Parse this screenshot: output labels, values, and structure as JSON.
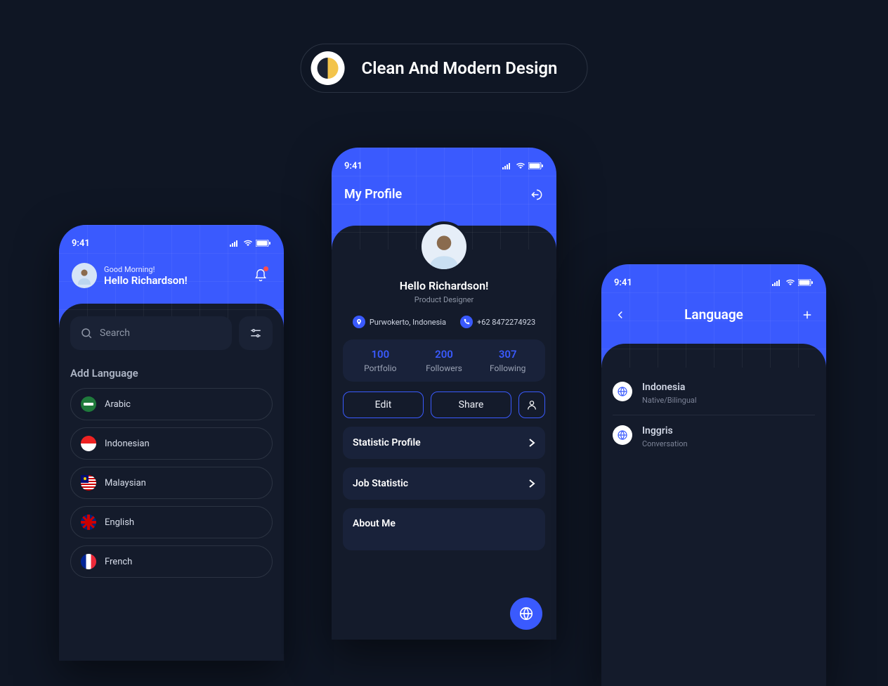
{
  "header": {
    "title": "Clean And Modern Design"
  },
  "status_time": "9:41",
  "left": {
    "greeting_sub": "Good Morning!",
    "greeting_main": "Hello Richardson!",
    "search_placeholder": "Search",
    "section_title": "Add Language",
    "languages": [
      {
        "label": "Arabic"
      },
      {
        "label": "Indonesian"
      },
      {
        "label": "Malaysian"
      },
      {
        "label": "English"
      },
      {
        "label": "French"
      }
    ]
  },
  "mid": {
    "page_title": "My Profile",
    "name": "Hello Richardson!",
    "role": "Product Designer",
    "location": "Purwokerto, Indonesia",
    "phone": "+62 8472274923",
    "stats": {
      "portfolio": {
        "num": "100",
        "label": "Portfolio"
      },
      "followers": {
        "num": "200",
        "label": "Followers"
      },
      "following": {
        "num": "307",
        "label": "Following"
      }
    },
    "edit_label": "Edit",
    "share_label": "Share",
    "row1": "Statistic Profile",
    "row2": "Job Statistic",
    "about_title": "About Me"
  },
  "right": {
    "page_title": "Language",
    "items": [
      {
        "name": "Indonesia",
        "level": "Native/Bilingual"
      },
      {
        "name": "Inggris",
        "level": "Conversation"
      }
    ]
  }
}
